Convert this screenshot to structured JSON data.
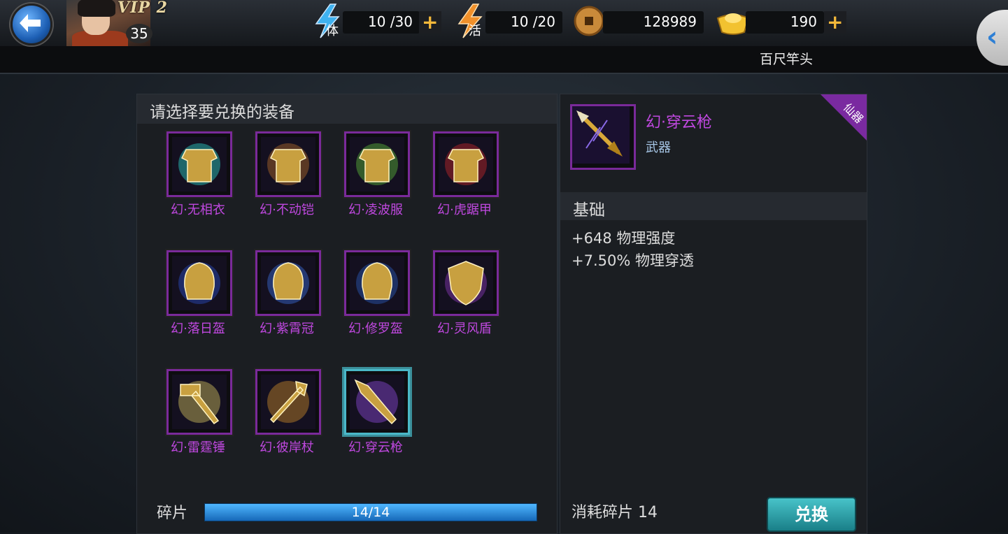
{
  "header": {
    "vip_label": "VIP 2",
    "level": "35",
    "stamina": {
      "label": "体",
      "value": "10 /30"
    },
    "activity": {
      "label": "活",
      "value": "10 /20"
    },
    "coins": {
      "value": "128989"
    },
    "gold": {
      "value": "190"
    },
    "subtitle": "百尺竿头"
  },
  "left_panel": {
    "title": "请选择要兑换的装备",
    "items": [
      {
        "name": "幻·无相衣",
        "icon": "armor-icon",
        "color": "#2bd1c6"
      },
      {
        "name": "幻·不动铠",
        "icon": "armor-icon",
        "color": "#b06a2a"
      },
      {
        "name": "幻·凌波服",
        "icon": "armor-icon",
        "color": "#5ab83a"
      },
      {
        "name": "幻·虎踞甲",
        "icon": "armor-icon",
        "color": "#c0282a"
      },
      {
        "name": "幻·落日盔",
        "icon": "helmet-icon",
        "color": "#2a4ec0"
      },
      {
        "name": "幻·紫霄冠",
        "icon": "helmet-icon",
        "color": "#3a6cd8"
      },
      {
        "name": "幻·修罗盔",
        "icon": "helmet-icon",
        "color": "#2a5ab8"
      },
      {
        "name": "幻·灵风盾",
        "icon": "shield-icon",
        "color": "#8a3ab8"
      },
      {
        "name": "幻·雷霆锤",
        "icon": "hammer-icon",
        "color": "#d0c060"
      },
      {
        "name": "幻·彼岸杖",
        "icon": "staff-icon",
        "color": "#c88a2a"
      },
      {
        "name": "幻·穿云枪",
        "icon": "spear-icon",
        "color": "#8a4ad8"
      }
    ],
    "fragments_label": "碎片",
    "fragments_progress": "14/14",
    "fragments_ratio": 1
  },
  "right_panel": {
    "item_name": "幻·穿云枪",
    "item_type": "武器",
    "badge": "仙器",
    "section_title": "基础",
    "stats": [
      "+648 物理强度",
      "+7.50% 物理穿透"
    ],
    "cost_label": "消耗碎片 14",
    "exchange_button": "兑换"
  },
  "colors": {
    "rarity_purple": "#c048e0",
    "accent_teal": "#48c3c9",
    "bar_blue": "#1c7fd0"
  }
}
